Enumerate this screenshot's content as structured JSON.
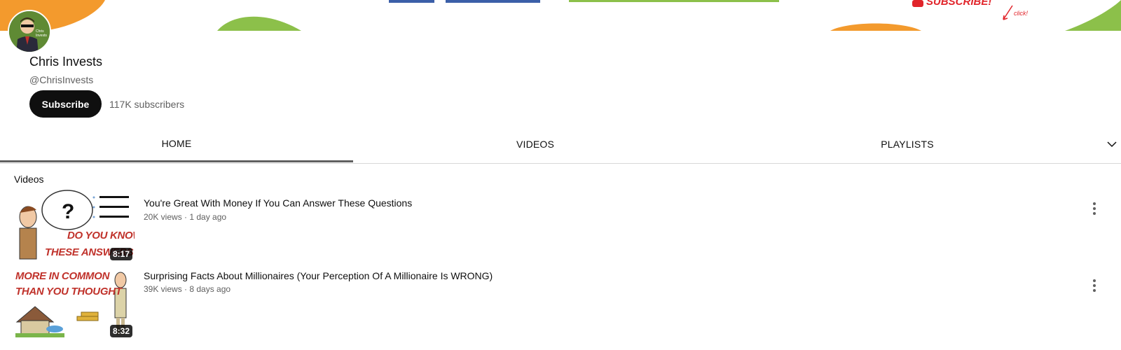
{
  "banner": {
    "subscribe_sticker": "SUBSCRIBE!",
    "click_note": "click!",
    "colors": {
      "orange": "#f39a2d",
      "green": "#8cc04a",
      "blue": "#3b5fa8",
      "red": "#e1242a"
    }
  },
  "channel": {
    "name": "Chris Invests",
    "handle": "@ChrisInvests",
    "subscribe_label": "Subscribe",
    "subscribers": "117K subscribers",
    "avatar_text": "Chris Invests"
  },
  "tabs": [
    {
      "label": "HOME",
      "active": true
    },
    {
      "label": "VIDEOS",
      "active": false
    },
    {
      "label": "PLAYLISTS",
      "active": false
    }
  ],
  "tabs_more_icon": "chevron-down-icon",
  "section": {
    "title": "Videos"
  },
  "videos": [
    {
      "title": "You're Great With Money If You Can Answer These Questions",
      "meta": "20K views · 1 day ago",
      "duration": "8:17",
      "thumb_text_1": "DO YOU KNOW",
      "thumb_text_2": "THESE ANSWERS?"
    },
    {
      "title": "Surprising Facts About Millionaires (Your Perception Of A Millionaire Is WRONG)",
      "meta": "39K views · 8 days ago",
      "duration": "8:32",
      "thumb_text_1": "MORE IN COMMON",
      "thumb_text_2": "THAN YOU THOUGHT"
    }
  ],
  "accent_colors": {
    "subscribe_bg": "#0f0f0f",
    "meta_text": "#606060",
    "thumb_text": "#c0322b"
  }
}
